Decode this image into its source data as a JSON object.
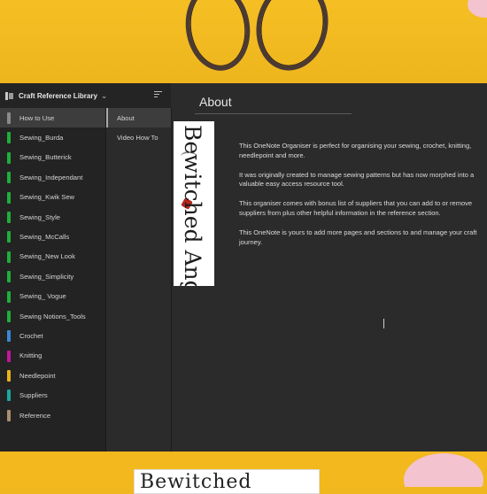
{
  "notebook": {
    "title": "Craft Reference Library",
    "chevron_icon": "chevron-down-icon",
    "sort_icon": "sort-icon"
  },
  "sections": [
    {
      "label": "How to Use",
      "color": "#8a8a8a",
      "selected": true
    },
    {
      "label": "Sewing_Burda",
      "color": "#1fae3a"
    },
    {
      "label": "Sewing_Butterick",
      "color": "#1fae3a"
    },
    {
      "label": "Sewing_Independant",
      "color": "#1fae3a"
    },
    {
      "label": "Sewing_Kwik Sew",
      "color": "#1fae3a"
    },
    {
      "label": "Sewing_Style",
      "color": "#1fae3a"
    },
    {
      "label": "Sewing_McCalls",
      "color": "#1fae3a"
    },
    {
      "label": "Sewing_New Look",
      "color": "#1fae3a"
    },
    {
      "label": "Sewing_Simplicity",
      "color": "#1fae3a"
    },
    {
      "label": "Sewing_ Vogue",
      "color": "#1fae3a"
    },
    {
      "label": "Sewing Notions_Tools",
      "color": "#1fae3a"
    },
    {
      "label": "Crochet",
      "color": "#3a86d6"
    },
    {
      "label": "Knitting",
      "color": "#c4169c"
    },
    {
      "label": "Needlepoint",
      "color": "#e8b21c"
    },
    {
      "label": "Suppliers",
      "color": "#19a8a0"
    },
    {
      "label": "Reference",
      "color": "#a98e6e"
    }
  ],
  "pages": [
    {
      "label": "About",
      "selected": true
    },
    {
      "label": "Video How To"
    }
  ],
  "content": {
    "title": "About",
    "logo_text": "Bewitched Angel",
    "paragraphs": [
      "This OneNote Organiser is perfect for organising your sewing, crochet, knitting, needlepoint and more.",
      "It was originally created to manage sewing patterns but has now morphed into a valuable easy access resource tool.",
      "This organiser comes with bonus list of suppliers that you can add to or remove suppliers from plus other helpful information in the reference section.",
      "This OneNote is yours to add more pages and sections to and manage your craft journey."
    ]
  },
  "footer": {
    "logo_text": "Bewitched Angel"
  }
}
